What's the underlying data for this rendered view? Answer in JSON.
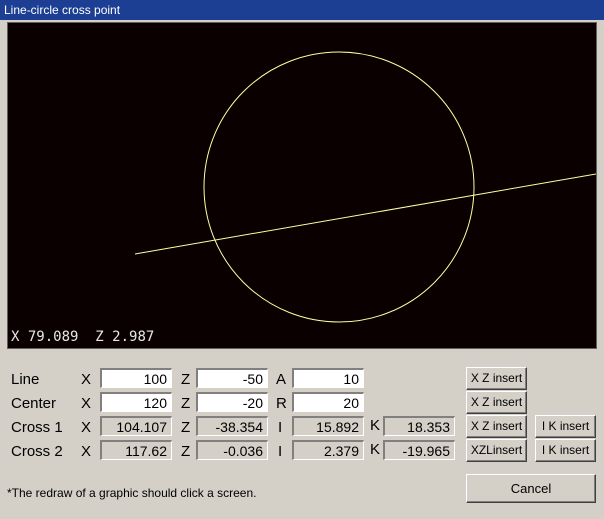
{
  "window": {
    "title": "Line-circle cross point"
  },
  "canvas": {
    "coord_x": "X 79.089",
    "coord_z": "Z 2.987",
    "line_color": "#ffffa0"
  },
  "rows": [
    {
      "label": "Line",
      "c1": "X",
      "v1": "100",
      "c2": "Z",
      "v2": "-50",
      "c3": "A",
      "v3": "10"
    },
    {
      "label": "Center",
      "c1": "X",
      "v1": "120",
      "c2": "Z",
      "v2": "-20",
      "c3": "R",
      "v3": "20"
    },
    {
      "label": "Cross 1",
      "c1": "X",
      "v1": "104.107",
      "c2": "Z",
      "v2": "-38.354",
      "c3": "I",
      "v3": "15.892",
      "c4": "K",
      "v4": "18.353"
    },
    {
      "label": "Cross 2",
      "c1": "X",
      "v1": "117.62",
      "c2": "Z",
      "v2": "-0.036",
      "c3": "I",
      "v3": "2.379",
      "c4": "K",
      "v4": "-19.965"
    }
  ],
  "buttons": {
    "xz1": "X Z insert",
    "xz2": "X Z insert",
    "xz3": "X Z insert",
    "xz4": "XZLinsert",
    "ik1": "I K insert",
    "ik2": "I K insert",
    "cancel": "Cancel"
  },
  "note": "*The redraw of a graphic should click a screen."
}
